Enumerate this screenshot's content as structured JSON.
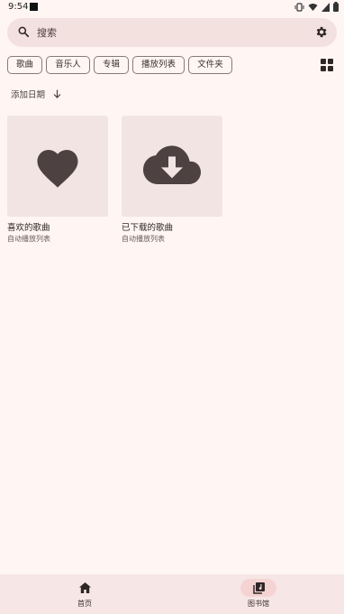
{
  "status_bar": {
    "time": "9:54"
  },
  "search": {
    "placeholder": "搜索"
  },
  "chips": [
    "歌曲",
    "音乐人",
    "专辑",
    "播放列表",
    "文件夹"
  ],
  "sort": {
    "label": "添加日期"
  },
  "cards": [
    {
      "title": "喜欢的歌曲",
      "subtitle": "自动播放列表",
      "icon": "heart-icon"
    },
    {
      "title": "已下载的歌曲",
      "subtitle": "自动播放列表",
      "icon": "cloud-download-icon"
    }
  ],
  "bottom_nav": [
    {
      "label": "首页",
      "icon": "home-icon",
      "active": false
    },
    {
      "label": "图书馆",
      "icon": "library-icon",
      "active": true
    }
  ],
  "colors": {
    "background": "#fff6f4",
    "search_bg": "#f3e1e0",
    "card_bg": "#f1e4e3",
    "icon": "#4e4141",
    "active_nav": "#f6d3d3"
  }
}
